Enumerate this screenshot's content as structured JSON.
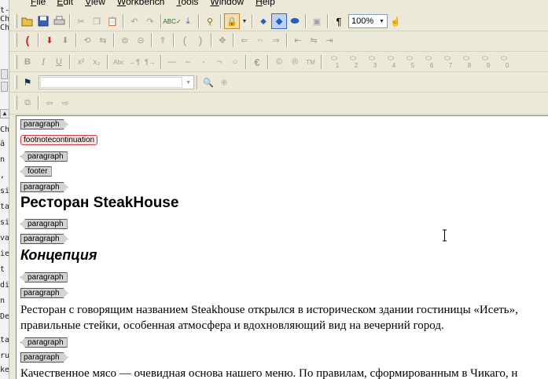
{
  "menubar": {
    "file": "File",
    "edit": "Edit",
    "view": "View",
    "workbench": "Workbench",
    "tools": "Tools",
    "window": "Window",
    "help": "Help"
  },
  "toolbar": {
    "zoom_value": "100%",
    "pilcrow": "¶",
    "euro": "€",
    "copyright": "©",
    "registered": "®",
    "trademark": "TM",
    "superscript": "x²",
    "subscript": "x₂",
    "smallcaps": "Abc",
    "bold": "B",
    "italic": "I",
    "underline": "U",
    "shortcut_numbers": [
      "1",
      "2",
      "3",
      "4",
      "5",
      "6",
      "7",
      "8",
      "9",
      "0"
    ]
  },
  "document": {
    "tags": {
      "paragraph": "paragraph",
      "footnotecontinuation": "footnotecontinuation",
      "footer": "footer"
    },
    "heading_1": "Ресторан SteakHouse",
    "heading_2": "Концепция",
    "paragraph_1_line_1": "Ресторан с говорящим названием Steakhouse открылся в историческом здании гостиницы «Исеть»,",
    "paragraph_1_line_2": "правильные стейки, особенная атмосфера и вдохновляющий вид на вечерний город.",
    "paragraph_2_line_1": "Качественное мясо — очевидная основа нашего меню. По правилам, сформированным в Чикаго, н"
  },
  "background_window": {
    "lines": [
      "t-",
      "Ch",
      "Ch",
      "ä",
      "n",
      ",",
      "si",
      "ta",
      "si",
      "va",
      "ie",
      "t",
      "di",
      "n",
      "De",
      "ta",
      "ru",
      "ke"
    ]
  },
  "colors": {
    "chrome": "#ece9d8",
    "tag_fill": "#d3d3d3",
    "tag_error_border": "#c84040",
    "toolbar_pressed": "#f6ddaa",
    "toolbar_selected": "#c1d2ee"
  }
}
